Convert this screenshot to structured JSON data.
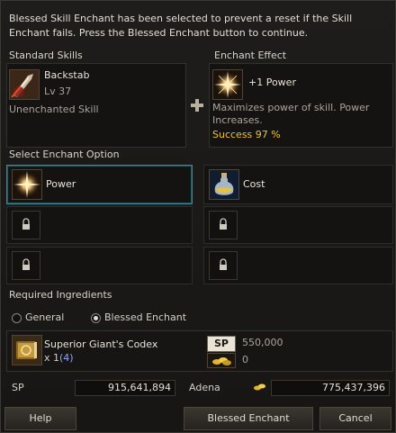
{
  "notice": "Blessed Skill Enchant has been selected to prevent a reset if the Skill Enchant fails. Press the Blessed Enchant button to continue.",
  "standard_skills": {
    "title": "Standard Skills",
    "skill_name": "Backstab",
    "level": "Lv 37",
    "status": "Unenchanted Skill"
  },
  "enchant_effect": {
    "title": "Enchant Effect",
    "effect": "+1 Power",
    "description": "Maximizes power of skill. Power Increases.",
    "success": "Success 97 %"
  },
  "select_option": {
    "title": "Select Enchant Option",
    "options": [
      "Power",
      "Cost"
    ]
  },
  "ingredients": {
    "title": "Required Ingredients",
    "radio_general": "General",
    "radio_blessed": "Blessed Enchant",
    "item_name": "Superior Giant's Codex",
    "item_qty": "x 1",
    "item_owned": "(4)",
    "sp_badge": "SP",
    "sp_cost": "550,000",
    "adena_cost": "0"
  },
  "totals": {
    "sp_label": "SP",
    "sp_value": "915,641,894",
    "adena_label": "Adena",
    "adena_value": "775,437,396"
  },
  "buttons": {
    "help": "Help",
    "blessed": "Blessed Enchant",
    "cancel": "Cancel"
  },
  "colors": {
    "success": "#f2c230",
    "owned": "#8ea6ff",
    "selection": "#2f8d9a"
  }
}
